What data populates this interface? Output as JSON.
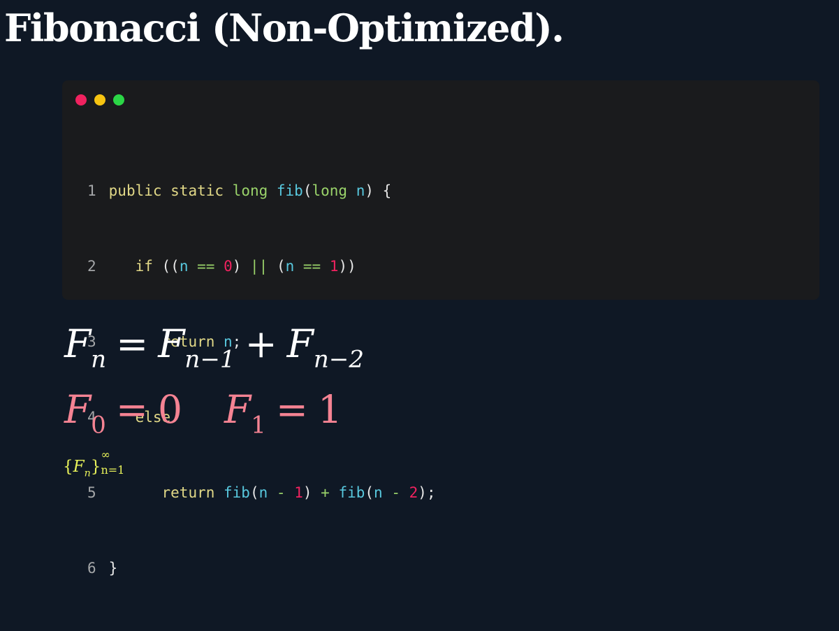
{
  "title": "Fibonacci (Non-Optimized).",
  "code_window": {
    "dots": [
      {
        "name": "close",
        "color": "#f0225f"
      },
      {
        "name": "minimize",
        "color": "#f7c411"
      },
      {
        "name": "maximize",
        "color": "#2bd646"
      }
    ],
    "lines": [
      {
        "n": "1",
        "t": [
          "public static ",
          " ",
          " fib",
          "(",
          "long",
          " n",
          ") {"
        ],
        "raw": "public static long fib(long n) {"
      },
      {
        "n": "2",
        "raw": "   if ((n == 0) || (n == 1))"
      },
      {
        "n": "3",
        "raw": "      return n;"
      },
      {
        "n": "4",
        "raw": "   else"
      },
      {
        "n": "5",
        "raw": "      return fib(n - 1) + fib(n - 2);"
      },
      {
        "n": "6",
        "raw": "}"
      }
    ],
    "tokens": {
      "l1": {
        "kw": "public static ",
        "type": "long",
        "fn": " fib",
        "p1": "(",
        "type2": "long",
        "var": " n",
        "p2": ") {"
      },
      "l2": {
        "indent": "   ",
        "kw": "if",
        "p1": " ((",
        "v1": "n",
        "op1": " == ",
        "n1": "0",
        "p2": ") ",
        "or": "||",
        "p3": " (",
        "v2": "n",
        "op2": " == ",
        "n2": "1",
        "p4": "))"
      },
      "l3": {
        "indent": "      ",
        "kw": "return",
        "v": " n",
        "p": ";"
      },
      "l4": {
        "indent": "   ",
        "kw": "else"
      },
      "l5": {
        "indent": "      ",
        "kw": "return",
        "fn1": " fib",
        "p1": "(",
        "v1": "n",
        "op1": " - ",
        "n1": "1",
        "p2": ") ",
        "plus": "+",
        "fn2": " fib",
        "p3": "(",
        "v2": "n",
        "op2": " - ",
        "n2": "2",
        "p4": ");"
      },
      "l6": {
        "p": "}"
      }
    }
  },
  "formulas": {
    "recurrence": {
      "F": "F",
      "n": "n",
      "eq": "=",
      "n1": "n−1",
      "plus": "+",
      "n2": "n−2"
    },
    "base": {
      "F": "F",
      "s0": "0",
      "eq": "=",
      "v0": "0",
      "s1": "1",
      "v1": "1"
    },
    "sequence": {
      "open": "{",
      "F": "F",
      "n": "n",
      "close": "}",
      "sup": "∞",
      "sub": "n=1"
    }
  },
  "colors": {
    "background": "#0f1825",
    "code_bg": "#1a1b1d",
    "keyword": "#e1d887",
    "type": "#9ad36a",
    "function": "#58c8de",
    "number": "#f0225f",
    "base_formula": "#f58393",
    "sequence_formula": "#e8f25a"
  }
}
